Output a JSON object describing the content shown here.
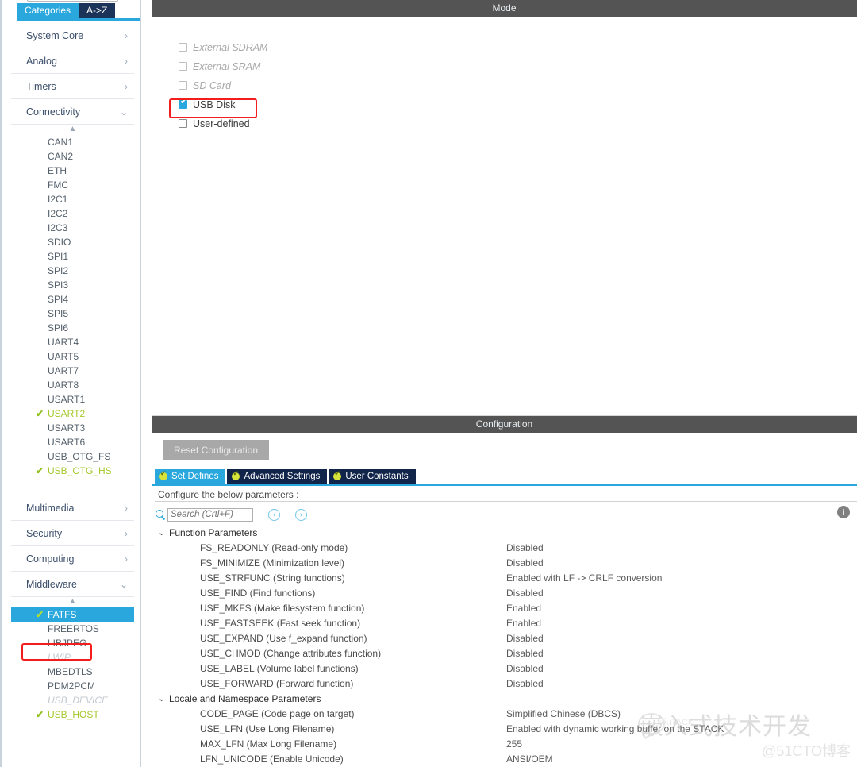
{
  "sidebar": {
    "tabs": [
      {
        "label": "Categories",
        "active": true
      },
      {
        "label": "A->Z",
        "active": false
      }
    ],
    "groups": [
      {
        "label": "System Core",
        "expanded": false,
        "chevron": "›"
      },
      {
        "label": "Analog",
        "expanded": false,
        "chevron": "›"
      },
      {
        "label": "Timers",
        "expanded": false,
        "chevron": "›"
      },
      {
        "label": "Connectivity",
        "expanded": true,
        "chevron": "⌄"
      }
    ],
    "connectivity_items": [
      {
        "label": "CAN1",
        "state": "normal"
      },
      {
        "label": "CAN2",
        "state": "normal"
      },
      {
        "label": "ETH",
        "state": "normal"
      },
      {
        "label": "FMC",
        "state": "normal"
      },
      {
        "label": "I2C1",
        "state": "normal"
      },
      {
        "label": "I2C2",
        "state": "normal"
      },
      {
        "label": "I2C3",
        "state": "normal"
      },
      {
        "label": "SDIO",
        "state": "normal"
      },
      {
        "label": "SPI1",
        "state": "normal"
      },
      {
        "label": "SPI2",
        "state": "normal"
      },
      {
        "label": "SPI3",
        "state": "normal"
      },
      {
        "label": "SPI4",
        "state": "normal"
      },
      {
        "label": "SPI5",
        "state": "normal"
      },
      {
        "label": "SPI6",
        "state": "normal"
      },
      {
        "label": "UART4",
        "state": "normal"
      },
      {
        "label": "UART5",
        "state": "normal"
      },
      {
        "label": "UART7",
        "state": "normal"
      },
      {
        "label": "UART8",
        "state": "normal"
      },
      {
        "label": "USART1",
        "state": "normal"
      },
      {
        "label": "USART2",
        "state": "enabled",
        "check": "✔"
      },
      {
        "label": "USART3",
        "state": "normal"
      },
      {
        "label": "USART6",
        "state": "normal"
      },
      {
        "label": "USB_OTG_FS",
        "state": "normal"
      },
      {
        "label": "USB_OTG_HS",
        "state": "enabled",
        "check": "✔"
      }
    ],
    "groups2": [
      {
        "label": "Multimedia",
        "expanded": false,
        "chevron": "›"
      },
      {
        "label": "Security",
        "expanded": false,
        "chevron": "›"
      },
      {
        "label": "Computing",
        "expanded": false,
        "chevron": "›"
      },
      {
        "label": "Middleware",
        "expanded": true,
        "chevron": "⌄"
      }
    ],
    "middleware_items": [
      {
        "label": "FATFS",
        "state": "selected",
        "check": "✔"
      },
      {
        "label": "FREERTOS",
        "state": "normal"
      },
      {
        "label": "LIBJPEG",
        "state": "normal"
      },
      {
        "label": "LWIP",
        "state": "disabled"
      },
      {
        "label": "MBEDTLS",
        "state": "normal"
      },
      {
        "label": "PDM2PCM",
        "state": "normal"
      },
      {
        "label": "USB_DEVICE",
        "state": "disabled"
      },
      {
        "label": "USB_HOST",
        "state": "enabled",
        "check": "✔"
      }
    ],
    "scroll_up_glyph": "▲"
  },
  "mode": {
    "title": "Mode",
    "options": [
      {
        "label": "External SDRAM",
        "checked": false,
        "dimmed": true
      },
      {
        "label": "External SRAM",
        "checked": false,
        "dimmed": true
      },
      {
        "label": "SD Card",
        "checked": false,
        "dimmed": true
      },
      {
        "label": "USB Disk",
        "checked": true,
        "dimmed": false,
        "highlighted": true
      },
      {
        "label": "User-defined",
        "checked": false,
        "dimmed": false
      }
    ]
  },
  "configuration": {
    "title": "Configuration",
    "reset_label": "Reset Configuration",
    "tabs": [
      {
        "label": "Set Defines",
        "active": true
      },
      {
        "label": "Advanced Settings",
        "active": false
      },
      {
        "label": "User Constants",
        "active": false
      }
    ],
    "hint": "Configure the below parameters :",
    "search_placeholder": "Search (Crtl+F)",
    "search_value": "",
    "nav_prev": "‹",
    "nav_next": "›",
    "info_glyph": "i",
    "groups": [
      {
        "label": "Function Parameters",
        "chevron": "⌄",
        "rows": [
          {
            "name": "FS_READONLY (Read-only mode)",
            "value": "Disabled"
          },
          {
            "name": "FS_MINIMIZE (Minimization level)",
            "value": "Disabled"
          },
          {
            "name": "USE_STRFUNC (String functions)",
            "value": "Enabled with LF -> CRLF conversion"
          },
          {
            "name": "USE_FIND (Find functions)",
            "value": "Disabled"
          },
          {
            "name": "USE_MKFS (Make filesystem function)",
            "value": "Enabled"
          },
          {
            "name": "USE_FASTSEEK (Fast seek function)",
            "value": "Enabled"
          },
          {
            "name": "USE_EXPAND (Use f_expand function)",
            "value": "Disabled"
          },
          {
            "name": "USE_CHMOD (Change attributes function)",
            "value": "Disabled"
          },
          {
            "name": "USE_LABEL (Volume label functions)",
            "value": "Disabled"
          },
          {
            "name": "USE_FORWARD (Forward function)",
            "value": "Disabled"
          }
        ]
      },
      {
        "label": "Locale and Namespace Parameters",
        "chevron": "⌄",
        "rows": [
          {
            "name": "CODE_PAGE (Code page on target)",
            "value": "Simplified Chinese (DBCS)"
          },
          {
            "name": "USE_LFN (Use Long Filename)",
            "value": "Enabled with dynamic working buffer on the STACK"
          },
          {
            "name": "MAX_LFN (Max Long Filename)",
            "value": "255"
          },
          {
            "name": "LFN_UNICODE (Enable Unicode)",
            "value": "ANSI/OEM"
          }
        ]
      }
    ]
  },
  "watermark": {
    "main": "嵌入式技术开发",
    "sub": "@51CTO博客",
    "tack": "tiểuTACK"
  },
  "colors": {
    "accent": "#2aa8dd",
    "tab_dark": "#11244a",
    "enabled_green": "#a5c82c",
    "highlight_red": "#f41d1d",
    "section_bar": "#545454"
  }
}
